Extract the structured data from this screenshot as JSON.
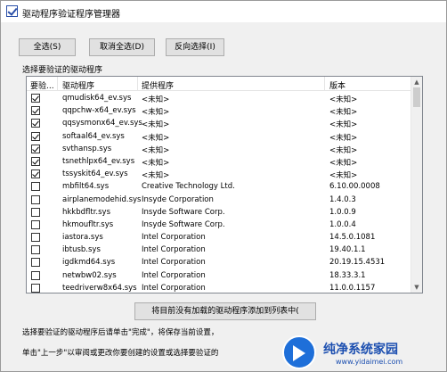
{
  "window": {
    "title": "驱动程序验证程序管理器"
  },
  "toolbar": {
    "select_all_label": "全选(S)",
    "deselect_all_label": "取消全选(D)",
    "invert_selection_label": "反向选择(I)"
  },
  "driver_list": {
    "section_label": "选择要验证的驱动程序",
    "columns": {
      "verify": "要验...",
      "driver": "驱动程序",
      "provider": "提供程序",
      "version": "版本"
    },
    "rows": [
      {
        "checked": true,
        "driver": "qmudisk64_ev.sys",
        "provider": "<未知>",
        "version": "<未知>"
      },
      {
        "checked": true,
        "driver": "qqpchw-x64_ev.sys",
        "provider": "<未知>",
        "version": "<未知>"
      },
      {
        "checked": true,
        "driver": "qqsysmonx64_ev.sys",
        "provider": "<未知>",
        "version": "<未知>"
      },
      {
        "checked": true,
        "driver": "softaal64_ev.sys",
        "provider": "<未知>",
        "version": "<未知>"
      },
      {
        "checked": true,
        "driver": "svthansp.sys",
        "provider": "<未知>",
        "version": "<未知>"
      },
      {
        "checked": true,
        "driver": "tsnethlpx64_ev.sys",
        "provider": "<未知>",
        "version": "<未知>"
      },
      {
        "checked": true,
        "driver": "tssyskit64_ev.sys",
        "provider": "<未知>",
        "version": "<未知>"
      },
      {
        "checked": false,
        "driver": "mbfilt64.sys",
        "provider": "Creative Technology Ltd.",
        "version": "6.10.00.0008"
      },
      {
        "checked": false,
        "driver": "airplanemodehid.sys",
        "provider": "Insyde Corporation",
        "version": "1.4.0.3"
      },
      {
        "checked": false,
        "driver": "hkkbdfltr.sys",
        "provider": "Insyde Software Corp.",
        "version": "1.0.0.9"
      },
      {
        "checked": false,
        "driver": "hkmoufltr.sys",
        "provider": "Insyde Software Corp.",
        "version": "1.0.0.4"
      },
      {
        "checked": false,
        "driver": "iastora.sys",
        "provider": "Intel Corporation",
        "version": "14.5.0.1081"
      },
      {
        "checked": false,
        "driver": "ibtusb.sys",
        "provider": "Intel Corporation",
        "version": "19.40.1.1"
      },
      {
        "checked": false,
        "driver": "igdkmd64.sys",
        "provider": "Intel Corporation",
        "version": "20.19.15.4531"
      },
      {
        "checked": false,
        "driver": "netwbw02.sys",
        "provider": "Intel Corporation",
        "version": "18.33.3.1"
      },
      {
        "checked": false,
        "driver": "teedriverw8x64.sys",
        "provider": "Intel Corporation",
        "version": "11.0.0.1157"
      }
    ]
  },
  "add_unlisted_label": "将目前没有加载的驱动程序添加到列表中(",
  "footer": {
    "note1": "选择要验证的驱动程序后请单击\"完成\"，将保存当前设置，",
    "note2": "单击\"上一步\"以审阅或更改你要创建的设置或选择要验证的"
  },
  "watermark": {
    "title": "纯净系统家园",
    "url": "www.yidaimei.com",
    "brand_color": "#1c4fb0"
  }
}
